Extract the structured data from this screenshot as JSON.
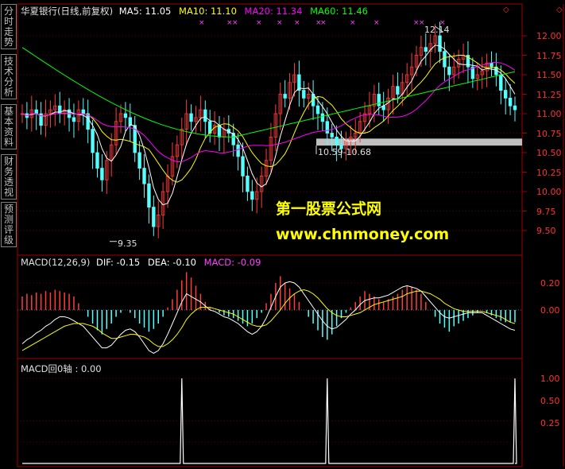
{
  "sidebar": {
    "tabs": [
      {
        "label": "分时走势"
      },
      {
        "label": "技术分析"
      },
      {
        "label": "基本资料"
      },
      {
        "label": "财务透视"
      },
      {
        "label": "预测评级"
      }
    ]
  },
  "colors": {
    "up": "#ff3c3c",
    "down": "#54ffff",
    "ma5": "#ffffff",
    "ma10": "#ffff00",
    "ma20": "#ff00ff",
    "ma60": "#00ff00",
    "frame": "#a00000",
    "band": "#c0c0c0",
    "watermark": "#ffff00"
  },
  "header": {
    "title": "华夏银行(日线,前复权)",
    "ma5": "MA5: 11.05",
    "ma10": "MA10: 11.10",
    "ma20": "MA20: 11.34",
    "ma60": "MA60: 11.46"
  },
  "price_panel": {
    "high_label": "12.14",
    "low_label": "9.35",
    "band_label": "10.59-10.68",
    "yticks": [
      "12.00",
      "11.75",
      "11.50",
      "11.25",
      "11.00",
      "10.75",
      "10.50",
      "10.25",
      "10.00",
      "9.75",
      "9.50"
    ]
  },
  "macd_panel": {
    "title": "MACD(12,26,9)",
    "dif": "DIF: -0.15",
    "dea": "DEA: -0.10",
    "macd": "MACD: -0.09",
    "yticks": [
      "0.20",
      "0.00"
    ]
  },
  "signal_panel": {
    "title": "MACD回0轴 : 0.00",
    "yticks": [
      "1.00",
      "0.50",
      "0.25"
    ]
  },
  "watermark": {
    "line1": "第一股票公式网",
    "line2": "www.chnmoney.com"
  },
  "chart_data": [
    {
      "type": "candlestick",
      "title": "华夏银行(日线,前复权)",
      "ylim": [
        9.3,
        12.2
      ],
      "yticks": [
        12.0,
        11.75,
        11.5,
        11.25,
        11.0,
        10.75,
        10.5,
        10.25,
        10.0,
        9.75,
        9.5
      ],
      "close": [
        11.0,
        10.95,
        11.05,
        11.0,
        10.85,
        11.0,
        11.05,
        11.1,
        11.0,
        11.05,
        10.95,
        10.9,
        11.05,
        11.0,
        10.8,
        10.5,
        10.3,
        10.15,
        10.4,
        10.6,
        10.9,
        11.0,
        10.95,
        10.85,
        10.5,
        10.3,
        10.1,
        9.8,
        9.55,
        9.7,
        10.0,
        10.2,
        10.45,
        10.6,
        10.8,
        11.0,
        10.9,
        10.95,
        11.05,
        10.9,
        10.75,
        10.85,
        10.7,
        10.8,
        10.75,
        10.6,
        10.45,
        10.2,
        10.0,
        9.9,
        10.0,
        10.2,
        10.4,
        10.7,
        11.0,
        11.25,
        11.2,
        11.4,
        11.5,
        11.3,
        11.2,
        11.25,
        11.1,
        11.0,
        10.9,
        10.75,
        10.7,
        10.6,
        10.55,
        10.65,
        10.7,
        10.75,
        10.9,
        11.0,
        11.1,
        11.25,
        11.1,
        11.05,
        11.2,
        11.35,
        11.25,
        11.4,
        11.5,
        11.6,
        11.75,
        11.85,
        11.8,
        11.9,
        12.0,
        11.8,
        11.6,
        11.5,
        11.6,
        11.7,
        11.75,
        11.6,
        11.45,
        11.5,
        11.55,
        11.65,
        11.6,
        11.5,
        11.3,
        11.2,
        11.1,
        11.05
      ],
      "ma5": [
        11.0,
        10.98,
        10.99,
        11.0,
        10.97,
        10.97,
        10.99,
        11.02,
        11.02,
        11.04,
        11.03,
        11.0,
        10.99,
        10.98,
        10.94,
        10.85,
        10.73,
        10.55,
        10.43,
        10.39,
        10.47,
        10.58,
        10.77,
        10.86,
        10.84,
        10.72,
        10.54,
        10.31,
        10.05,
        9.9,
        9.83,
        9.85,
        9.98,
        10.19,
        10.41,
        10.61,
        10.75,
        10.85,
        10.94,
        10.96,
        10.91,
        10.9,
        10.85,
        10.8,
        10.77,
        10.74,
        10.67,
        10.56,
        10.4,
        10.23,
        10.11,
        10.06,
        10.1,
        10.24,
        10.46,
        10.71,
        10.91,
        11.11,
        11.27,
        11.33,
        11.32,
        11.33,
        11.25,
        11.17,
        11.09,
        11.0,
        10.89,
        10.79,
        10.71,
        10.65,
        10.65,
        10.65,
        10.71,
        10.8,
        10.89,
        11.0,
        11.07,
        11.1,
        11.14,
        11.19,
        11.19,
        11.25,
        11.34,
        11.42,
        11.55,
        11.67,
        11.74,
        11.82,
        11.88,
        11.87,
        11.83,
        11.76,
        11.7,
        11.64,
        11.63,
        11.63,
        11.62,
        11.61,
        11.56,
        11.58,
        11.57,
        11.56,
        11.52,
        11.45,
        11.35,
        11.25
      ]
    },
    {
      "type": "bar",
      "title": "MACD(12,26,9)",
      "ylim": [
        -0.36,
        0.32
      ],
      "yticks": [
        0.2,
        0.0
      ],
      "macd": [
        0.1,
        0.12,
        0.11,
        0.13,
        0.12,
        0.14,
        0.13,
        0.15,
        0.14,
        0.13,
        0.12,
        0.1,
        0.05,
        0.0,
        -0.05,
        -0.1,
        -0.15,
        -0.18,
        -0.14,
        -0.1,
        -0.05,
        -0.02,
        0.0,
        -0.02,
        -0.06,
        -0.1,
        -0.13,
        -0.16,
        -0.14,
        -0.1,
        -0.05,
        0.02,
        0.08,
        0.15,
        0.22,
        0.28,
        0.24,
        0.18,
        0.12,
        0.06,
        0.02,
        0.0,
        -0.02,
        -0.04,
        -0.05,
        -0.06,
        -0.08,
        -0.1,
        -0.12,
        -0.1,
        -0.06,
        -0.02,
        0.05,
        0.12,
        0.2,
        0.25,
        0.2,
        0.16,
        0.12,
        0.06,
        0.0,
        -0.05,
        -0.1,
        -0.15,
        -0.2,
        -0.22,
        -0.18,
        -0.12,
        -0.06,
        -0.02,
        0.02,
        0.06,
        0.1,
        0.14,
        0.12,
        0.1,
        0.08,
        0.06,
        0.08,
        0.1,
        0.12,
        0.15,
        0.18,
        0.17,
        0.15,
        0.12,
        0.06,
        0.0,
        -0.05,
        -0.1,
        -0.13,
        -0.16,
        -0.12,
        -0.1,
        -0.08,
        -0.06,
        -0.04,
        -0.02,
        0.0,
        -0.02,
        -0.04,
        -0.06,
        -0.08,
        -0.09,
        -0.09,
        -0.09
      ],
      "dif": [
        -0.25,
        -0.22,
        -0.2,
        -0.17,
        -0.15,
        -0.12,
        -0.1,
        -0.07,
        -0.05,
        -0.05,
        -0.06,
        -0.08,
        -0.1,
        -0.12,
        -0.16,
        -0.2,
        -0.24,
        -0.28,
        -0.28,
        -0.26,
        -0.22,
        -0.18,
        -0.15,
        -0.14,
        -0.16,
        -0.2,
        -0.25,
        -0.3,
        -0.32,
        -0.3,
        -0.25,
        -0.18,
        -0.1,
        -0.02,
        0.06,
        0.12,
        0.1,
        0.08,
        0.06,
        0.03,
        0.0,
        -0.01,
        -0.03,
        -0.05,
        -0.06,
        -0.08,
        -0.1,
        -0.13,
        -0.16,
        -0.18,
        -0.16,
        -0.12,
        -0.06,
        0.02,
        0.1,
        0.17,
        0.2,
        0.21,
        0.2,
        0.17,
        0.12,
        0.07,
        0.02,
        -0.03,
        -0.08,
        -0.12,
        -0.14,
        -0.13,
        -0.1,
        -0.07,
        -0.03,
        0.0,
        0.04,
        0.07,
        0.08,
        0.09,
        0.09,
        0.1,
        0.11,
        0.13,
        0.15,
        0.17,
        0.18,
        0.17,
        0.16,
        0.14,
        0.1,
        0.06,
        0.02,
        -0.02,
        -0.05,
        -0.06,
        -0.05,
        -0.04,
        -0.03,
        -0.02,
        -0.02,
        -0.02,
        -0.02,
        -0.04,
        -0.06,
        -0.08,
        -0.1,
        -0.12,
        -0.14,
        -0.15
      ],
      "dea": [
        -0.3,
        -0.28,
        -0.26,
        -0.24,
        -0.22,
        -0.2,
        -0.18,
        -0.16,
        -0.14,
        -0.12,
        -0.11,
        -0.1,
        -0.1,
        -0.1,
        -0.11,
        -0.12,
        -0.14,
        -0.17,
        -0.19,
        -0.21,
        -0.21,
        -0.2,
        -0.19,
        -0.18,
        -0.18,
        -0.19,
        -0.2,
        -0.22,
        -0.25,
        -0.27,
        -0.27,
        -0.25,
        -0.22,
        -0.18,
        -0.13,
        -0.07,
        -0.03,
        0.0,
        0.02,
        0.02,
        0.02,
        0.01,
        0.0,
        -0.01,
        -0.02,
        -0.03,
        -0.05,
        -0.07,
        -0.09,
        -0.11,
        -0.12,
        -0.12,
        -0.11,
        -0.08,
        -0.04,
        0.0,
        0.05,
        0.09,
        0.12,
        0.14,
        0.15,
        0.14,
        0.12,
        0.09,
        0.05,
        0.01,
        -0.02,
        -0.04,
        -0.05,
        -0.05,
        -0.04,
        -0.03,
        -0.02,
        0.0,
        0.02,
        0.04,
        0.05,
        0.06,
        0.07,
        0.08,
        0.09,
        0.1,
        0.12,
        0.13,
        0.14,
        0.14,
        0.13,
        0.12,
        0.1,
        0.08,
        0.05,
        0.03,
        0.01,
        0.0,
        -0.01,
        -0.01,
        -0.01,
        -0.01,
        -0.01,
        -0.02,
        -0.03,
        -0.04,
        -0.05,
        -0.07,
        -0.09,
        -0.1
      ]
    },
    {
      "type": "line",
      "title": "MACD回0轴",
      "ylim": [
        0,
        1.0
      ],
      "yticks": [
        1.0,
        0.5,
        0.25
      ],
      "values_index_spikes": [
        35,
        66,
        106
      ],
      "length": 106
    }
  ]
}
